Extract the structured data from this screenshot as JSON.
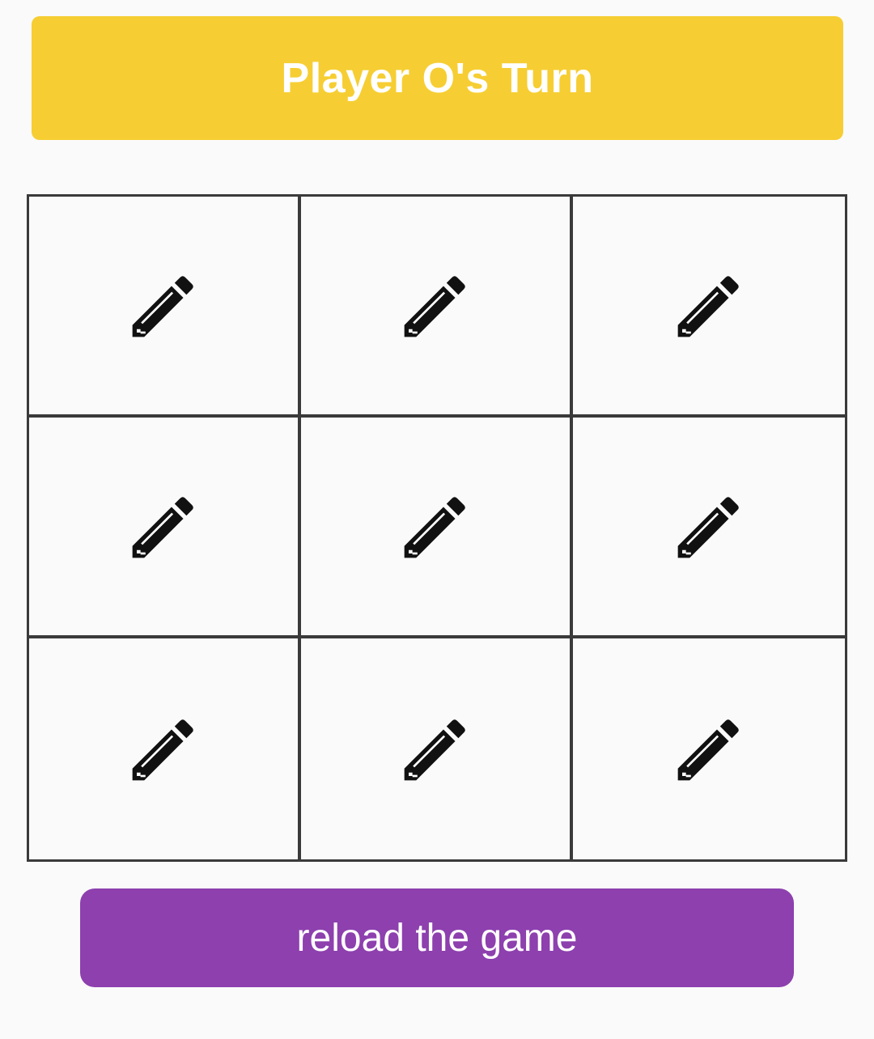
{
  "banner": {
    "text": "Player O's Turn",
    "color": "#f6ce33"
  },
  "board": {
    "cells": [
      {
        "icon": "pencil-icon",
        "mark": ""
      },
      {
        "icon": "pencil-icon",
        "mark": ""
      },
      {
        "icon": "pencil-icon",
        "mark": ""
      },
      {
        "icon": "pencil-icon",
        "mark": ""
      },
      {
        "icon": "pencil-icon",
        "mark": ""
      },
      {
        "icon": "pencil-icon",
        "mark": ""
      },
      {
        "icon": "pencil-icon",
        "mark": ""
      },
      {
        "icon": "pencil-icon",
        "mark": ""
      },
      {
        "icon": "pencil-icon",
        "mark": ""
      }
    ],
    "border_color": "#3a3a3a"
  },
  "reload": {
    "label": "reload the game",
    "color": "#8d40ae"
  }
}
